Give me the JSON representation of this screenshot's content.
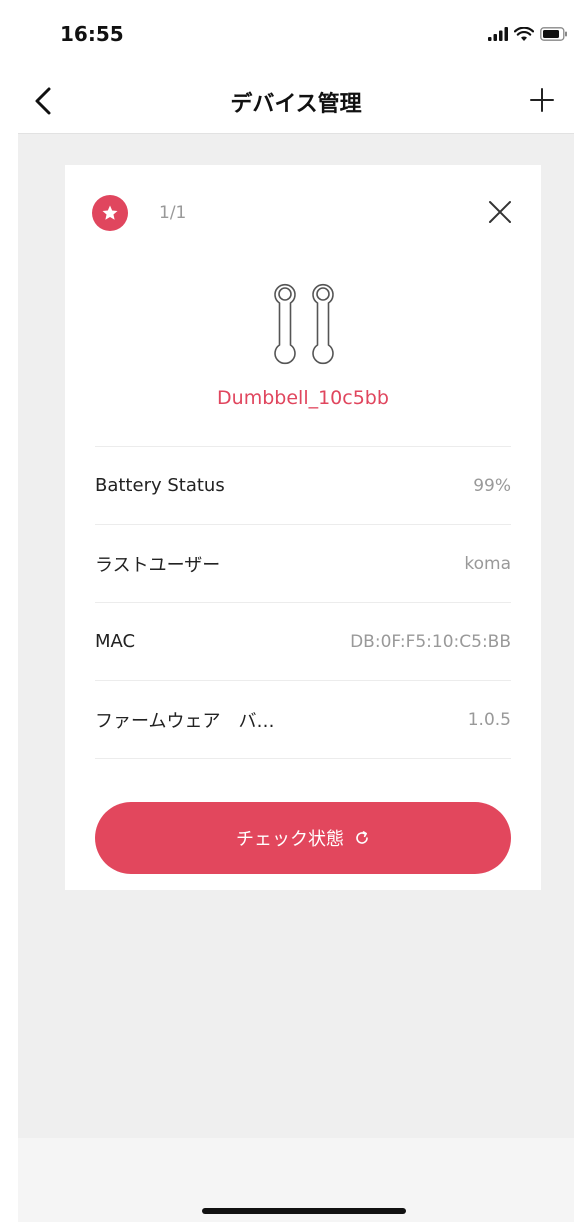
{
  "status_bar": {
    "time": "16:55",
    "icons": [
      "cellular-signal-icon",
      "wifi-icon",
      "battery-icon"
    ]
  },
  "nav": {
    "title": "デバイス管理",
    "back_icon": "chevron-left-icon",
    "add_icon": "plus-icon"
  },
  "card": {
    "badge_icon": "star-icon",
    "page_indicator": "1/1",
    "close_icon": "close-icon",
    "device_icon": "dumbbell-icon",
    "device_name": "Dumbbell_10c5bb",
    "rows": [
      {
        "label": "Battery Status",
        "value": "99%"
      },
      {
        "label": "ラストユーザー",
        "value": "koma"
      },
      {
        "label": "MAC",
        "value": "DB:0F:F5:10:C5:BB"
      },
      {
        "label": "ファームウェア　バ…",
        "value": "1.0.5"
      }
    ],
    "button": {
      "label": "チェック状態",
      "icon": "refresh-icon"
    }
  },
  "colors": {
    "accent": "#e0465e",
    "background": "#efefef",
    "card": "#ffffff",
    "muted_text": "#999999"
  }
}
